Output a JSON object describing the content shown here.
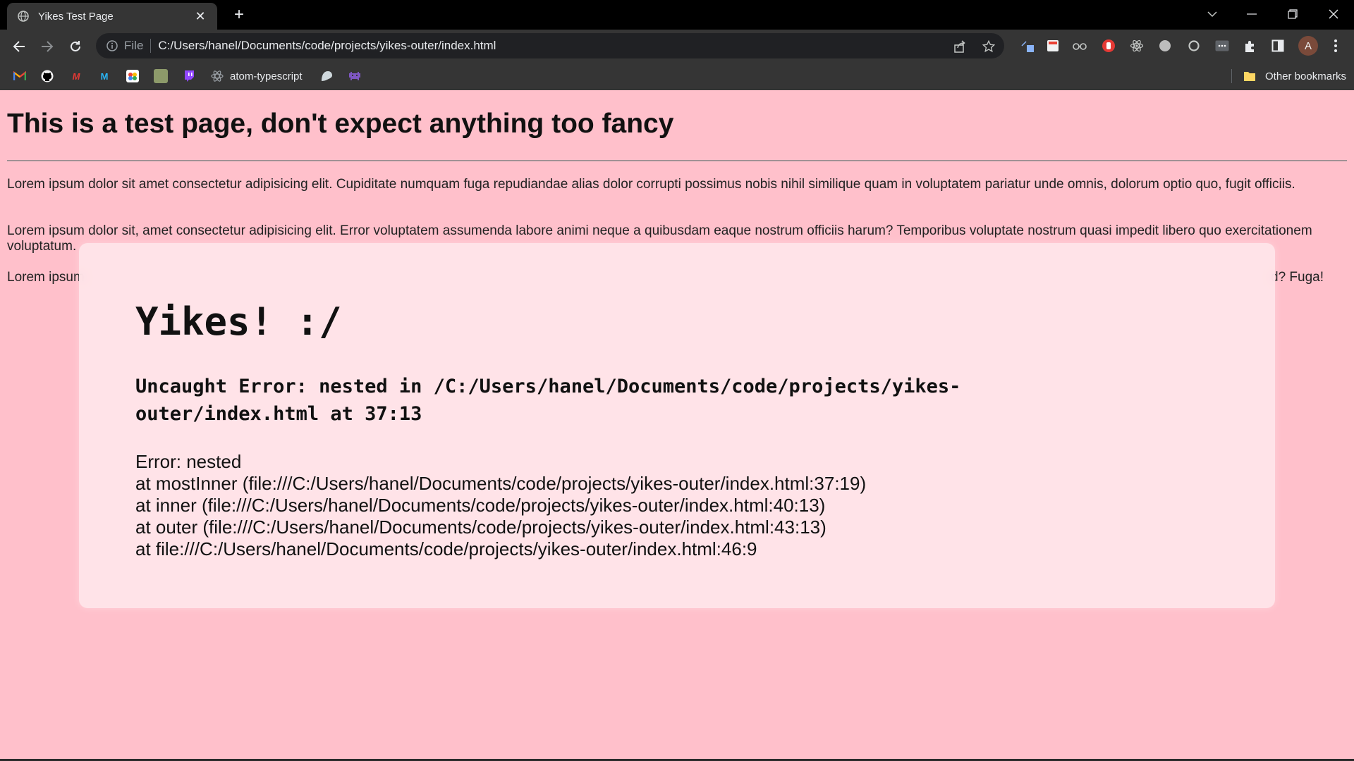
{
  "browser": {
    "tab": {
      "title": "Yikes Test Page",
      "close_glyph": "✕"
    },
    "new_tab_glyph": "+",
    "address": {
      "scheme": "File",
      "url": "C:/Users/hanel/Documents/code/projects/yikes-outer/index.html"
    },
    "bookmarks": [
      {
        "name": "gmail-icon",
        "label": ""
      },
      {
        "name": "github-icon",
        "label": ""
      },
      {
        "name": "bookmark-icon",
        "label": ""
      },
      {
        "name": "bookmark-icon",
        "label": ""
      },
      {
        "name": "bookmark-icon",
        "label": ""
      },
      {
        "name": "bookmark-icon",
        "label": ""
      },
      {
        "name": "twitch-icon",
        "label": ""
      },
      {
        "name": "atom-icon",
        "label": "atom-typescript"
      }
    ],
    "other_bookmarks": "Other bookmarks",
    "profile_initial": "A",
    "colors": {
      "chrome": "#353535",
      "tabbar": "#000000",
      "omnibox": "#202124",
      "page_bg": "#ffc0cb"
    }
  },
  "page": {
    "title": "This is a test page, don't expect anything too fancy",
    "paragraphs": [
      "Lorem ipsum dolor sit amet consectetur adipisicing elit. Cupiditate numquam fuga repudiandae alias dolor corrupti possimus nobis nihil similique quam in voluptatem pariatur unde omnis, dolorum optio quo, fugit officiis.",
      "Lorem ipsum dolor sit, amet consectetur adipisicing elit. Error voluptatem assumenda labore animi neque a quibusdam eaque nostrum officiis harum? Temporibus voluptate nostrum quasi impedit libero quo exercitationem voluptatum.",
      "Lorem ipsum"
    ],
    "paragraph3_tail": "d? Fuga!"
  },
  "overlay": {
    "title": "Yikes! :/",
    "error_heading": "Uncaught Error: nested in /C:/Users/hanel/Documents/code/projects/yikes-outer/index.html at 37:13",
    "stack": [
      "Error: nested",
      "at mostInner (file:///C:/Users/hanel/Documents/code/projects/yikes-outer/index.html:37:19)",
      "at inner (file:///C:/Users/hanel/Documents/code/projects/yikes-outer/index.html:40:13)",
      "at outer (file:///C:/Users/hanel/Documents/code/projects/yikes-outer/index.html:43:13)",
      "at file:///C:/Users/hanel/Documents/code/projects/yikes-outer/index.html:46:9"
    ]
  }
}
